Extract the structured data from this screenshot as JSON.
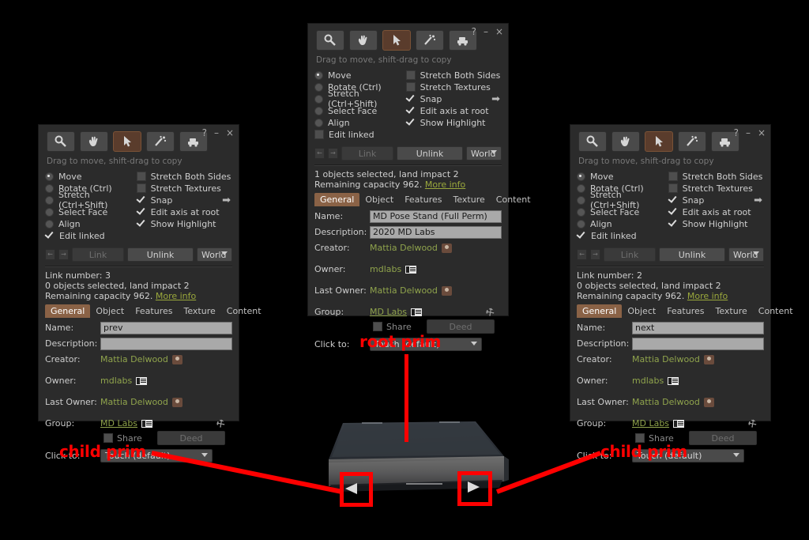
{
  "panels": [
    {
      "id": "left",
      "hint": "Drag to move, shift-drag to copy",
      "help": "?",
      "minimize": "–",
      "close": "×",
      "tools": [
        "zoom-icon",
        "grab-hand-icon",
        "edit-cursor-icon",
        "create-wand-icon",
        "land-terraform-icon"
      ],
      "radios": [
        {
          "label": "Move",
          "checked": true
        },
        {
          "label": "Rotate (Ctrl)",
          "checked": false
        },
        {
          "label": "Stretch (Ctrl+Shift)",
          "checked": false
        },
        {
          "label": "Select Face",
          "checked": false
        },
        {
          "label": "Align",
          "checked": false
        }
      ],
      "edit_linked": {
        "label": "Edit linked",
        "checked": true
      },
      "checks": [
        {
          "label": "Stretch Both Sides",
          "checked": false
        },
        {
          "label": "Stretch Textures",
          "checked": false
        },
        {
          "label": "Snap",
          "checked": true
        },
        {
          "label": "Edit axis at root",
          "checked": true
        },
        {
          "label": "Show Highlight",
          "checked": true
        }
      ],
      "link_button": "Link",
      "unlink_button": "Unlink",
      "reference_frame": "World",
      "status_line1": "Link number: 3",
      "status_line2": "0 objects selected, land impact 2",
      "status_line3": "Remaining capacity 962.",
      "more_info": "More info",
      "tabs": [
        "General",
        "Object",
        "Features",
        "Texture",
        "Content"
      ],
      "active_tab": "General",
      "fields": {
        "name_label": "Name:",
        "name_value": "prev",
        "desc_label": "Description:",
        "desc_value": "",
        "creator_label": "Creator:",
        "creator_value": "Mattia Delwood",
        "owner_label": "Owner:",
        "owner_value": "mdlabs",
        "last_owner_label": "Last Owner:",
        "last_owner_value": "Mattia Delwood",
        "group_label": "Group:",
        "group_value": "MD Labs",
        "share_label": "Share",
        "share_checked": false,
        "deed_label": "Deed",
        "click_to_label": "Click to:",
        "click_to_value": "Touch  (default)"
      }
    },
    {
      "id": "center",
      "hint": "Drag to move, shift-drag to copy",
      "help": "?",
      "minimize": "–",
      "close": "×",
      "tools": [
        "zoom-icon",
        "grab-hand-icon",
        "edit-cursor-icon",
        "create-wand-icon",
        "land-terraform-icon"
      ],
      "radios": [
        {
          "label": "Move",
          "checked": true
        },
        {
          "label": "Rotate (Ctrl)",
          "checked": false
        },
        {
          "label": "Stretch (Ctrl+Shift)",
          "checked": false
        },
        {
          "label": "Select Face",
          "checked": false
        },
        {
          "label": "Align",
          "checked": false
        }
      ],
      "edit_linked": {
        "label": "Edit linked",
        "checked": false
      },
      "checks": [
        {
          "label": "Stretch Both Sides",
          "checked": false
        },
        {
          "label": "Stretch Textures",
          "checked": false
        },
        {
          "label": "Snap",
          "checked": true
        },
        {
          "label": "Edit axis at root",
          "checked": true
        },
        {
          "label": "Show Highlight",
          "checked": true
        }
      ],
      "link_button": "Link",
      "unlink_button": "Unlink",
      "reference_frame": "World",
      "status_line1": "",
      "status_line2": "1 objects selected, land impact 2",
      "status_line3": "Remaining capacity 962.",
      "more_info": "More info",
      "tabs": [
        "General",
        "Object",
        "Features",
        "Texture",
        "Content"
      ],
      "active_tab": "General",
      "fields": {
        "name_label": "Name:",
        "name_value": "MD Pose Stand (Full Perm)",
        "desc_label": "Description:",
        "desc_value": "2020 MD Labs",
        "creator_label": "Creator:",
        "creator_value": "Mattia Delwood",
        "owner_label": "Owner:",
        "owner_value": "mdlabs",
        "last_owner_label": "Last Owner:",
        "last_owner_value": "Mattia Delwood",
        "group_label": "Group:",
        "group_value": "MD Labs",
        "share_label": "Share",
        "share_checked": false,
        "deed_label": "Deed",
        "click_to_label": "Click to:",
        "click_to_value": "Touch  (default)"
      }
    },
    {
      "id": "right",
      "hint": "Drag to move, shift-drag to copy",
      "help": "?",
      "minimize": "–",
      "close": "×",
      "tools": [
        "zoom-icon",
        "grab-hand-icon",
        "edit-cursor-icon",
        "create-wand-icon",
        "land-terraform-icon"
      ],
      "radios": [
        {
          "label": "Move",
          "checked": true
        },
        {
          "label": "Rotate (Ctrl)",
          "checked": false
        },
        {
          "label": "Stretch (Ctrl+Shift)",
          "checked": false
        },
        {
          "label": "Select Face",
          "checked": false
        },
        {
          "label": "Align",
          "checked": false
        }
      ],
      "edit_linked": {
        "label": "Edit linked",
        "checked": true
      },
      "checks": [
        {
          "label": "Stretch Both Sides",
          "checked": false
        },
        {
          "label": "Stretch Textures",
          "checked": false
        },
        {
          "label": "Snap",
          "checked": true
        },
        {
          "label": "Edit axis at root",
          "checked": true
        },
        {
          "label": "Show Highlight",
          "checked": true
        }
      ],
      "link_button": "Link",
      "unlink_button": "Unlink",
      "reference_frame": "World",
      "status_line1": "Link number: 2",
      "status_line2": "0 objects selected, land impact 2",
      "status_line3": "Remaining capacity 962.",
      "more_info": "More info",
      "tabs": [
        "General",
        "Object",
        "Features",
        "Texture",
        "Content"
      ],
      "active_tab": "General",
      "fields": {
        "name_label": "Name:",
        "name_value": "next",
        "desc_label": "Description:",
        "desc_value": "",
        "creator_label": "Creator:",
        "creator_value": "Mattia Delwood",
        "owner_label": "Owner:",
        "owner_value": "mdlabs",
        "last_owner_label": "Last Owner:",
        "last_owner_value": "Mattia Delwood",
        "group_label": "Group:",
        "group_value": "MD Labs",
        "share_label": "Share",
        "share_checked": false,
        "deed_label": "Deed",
        "click_to_label": "Click to:",
        "click_to_value": "Touch  (default)"
      }
    }
  ],
  "annotations": {
    "root_prim": "root prim",
    "child_prim_left": "child prim",
    "child_prim_right": "child prim",
    "color": "#ff0000"
  },
  "scene": {
    "object_name": "pose-stand-3d-object",
    "left_arrow_glyph": "◀",
    "right_arrow_glyph": "▶"
  }
}
